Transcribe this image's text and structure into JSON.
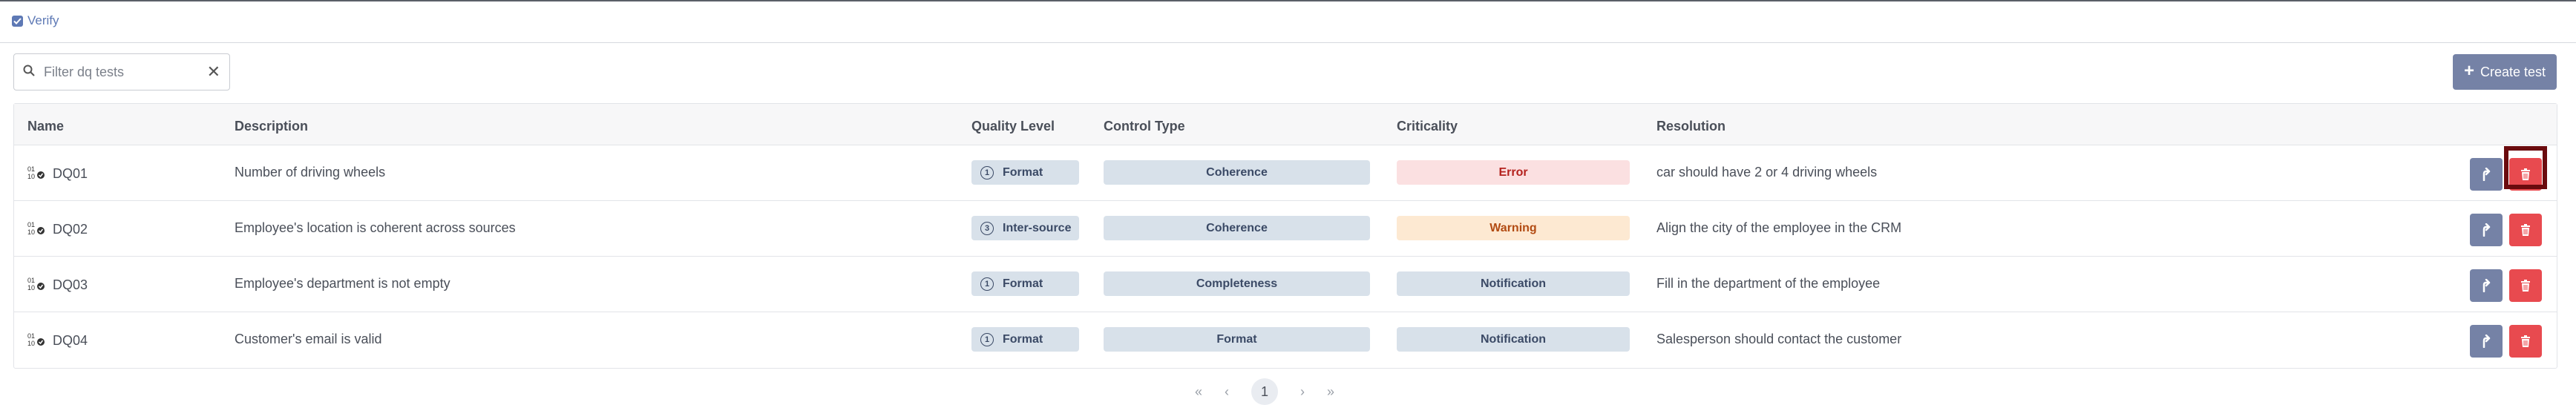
{
  "toolbar": {
    "verify_label": "Verify",
    "search_placeholder": "Filter dq tests",
    "create_label": "Create test"
  },
  "table": {
    "headers": {
      "name": "Name",
      "description": "Description",
      "quality_level": "Quality Level",
      "control_type": "Control Type",
      "criticality": "Criticality",
      "resolution": "Resolution"
    },
    "rows": [
      {
        "name": "DQ01",
        "description": "Number of driving wheels",
        "ql_num": "1",
        "ql": "Format",
        "ct": "Coherence",
        "crit": "Error",
        "res": "car should have 2 or 4 driving wheels"
      },
      {
        "name": "DQ02",
        "description": "Employee's location is coherent across sources",
        "ql_num": "3",
        "ql": "Inter-source",
        "ct": "Coherence",
        "crit": "Warning",
        "res": "Align the city of the employee in the CRM"
      },
      {
        "name": "DQ03",
        "description": "Employee's department is not empty",
        "ql_num": "1",
        "ql": "Format",
        "ct": "Completeness",
        "crit": "Notification",
        "res": "Fill in the department of the employee"
      },
      {
        "name": "DQ04",
        "description": "Customer's email is valid",
        "ql_num": "1",
        "ql": "Format",
        "ct": "Format",
        "crit": "Notification",
        "res": "Salesperson should contact the customer"
      }
    ]
  },
  "pagination": {
    "first": "«",
    "prev": "‹",
    "page": "1",
    "next": "›",
    "last": "»"
  },
  "colors": {
    "accent": "#7582a6",
    "danger": "#e84a4f",
    "highlight": "#6b0b0e"
  }
}
